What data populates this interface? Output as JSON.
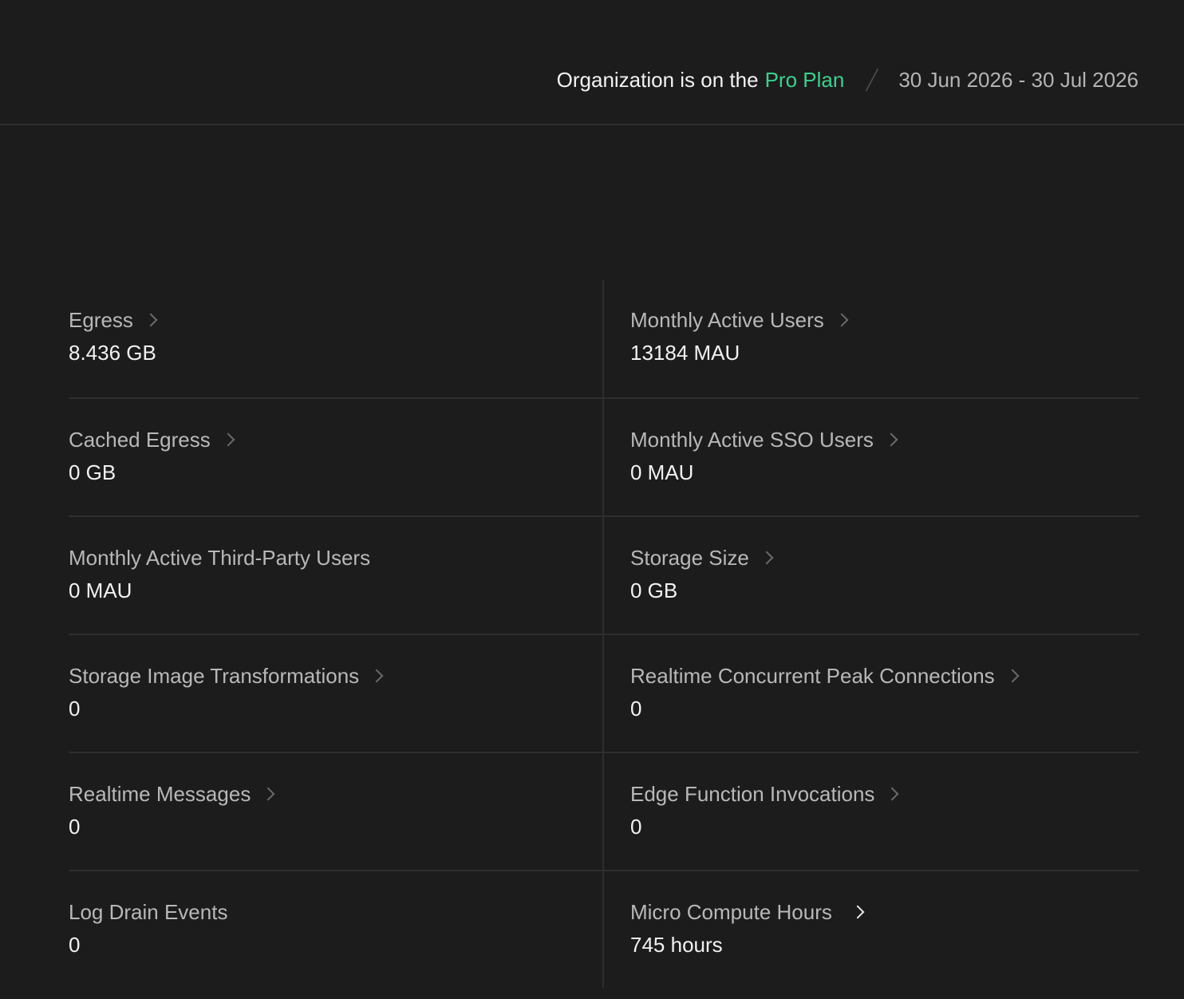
{
  "header": {
    "plan_prefix": "Organization is on the",
    "plan_name": "Pro Plan",
    "billing_period": "30 Jun 2026 - 30 Jul 2026"
  },
  "colors": {
    "background": "#1c1c1c",
    "accent": "#3ecf8e",
    "divider": "#2e2e2e"
  },
  "metrics": [
    {
      "label": "Egress",
      "value": "8.436 GB",
      "has_link": true
    },
    {
      "label": "Monthly Active Users",
      "value": "13184 MAU",
      "has_link": true
    },
    {
      "label": "Cached Egress",
      "value": "0 GB",
      "has_link": true
    },
    {
      "label": "Monthly Active SSO Users",
      "value": "0 MAU",
      "has_link": true
    },
    {
      "label": "Monthly Active Third-Party Users",
      "value": "0 MAU",
      "has_link": false
    },
    {
      "label": "Storage Size",
      "value": "0 GB",
      "has_link": true
    },
    {
      "label": "Storage Image Transformations",
      "value": "0",
      "has_link": true
    },
    {
      "label": "Realtime Concurrent Peak Connections",
      "value": "0",
      "has_link": true
    },
    {
      "label": "Realtime Messages",
      "value": "0",
      "has_link": true
    },
    {
      "label": "Edge Function Invocations",
      "value": "0",
      "has_link": true
    },
    {
      "label": "Log Drain Events",
      "value": "0",
      "has_link": false
    },
    {
      "label": "Micro Compute Hours",
      "value": "745 hours",
      "has_link": true
    }
  ]
}
